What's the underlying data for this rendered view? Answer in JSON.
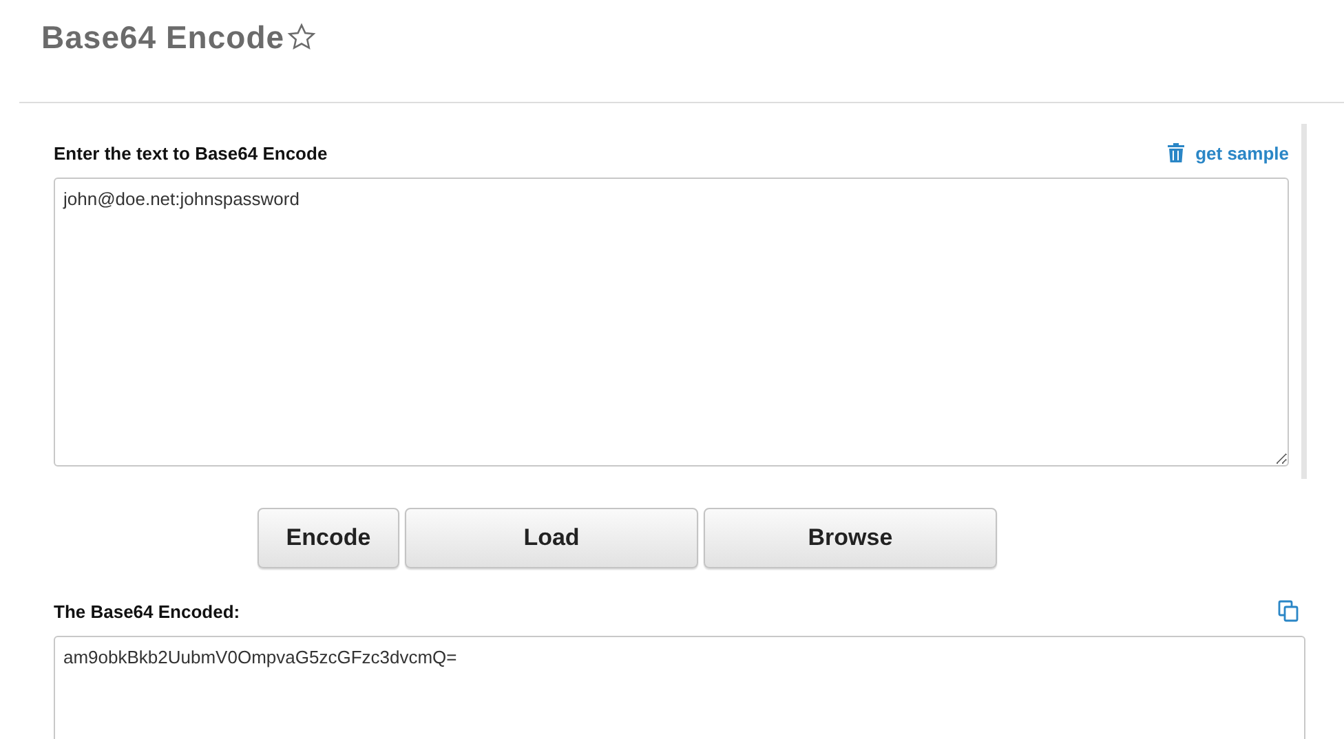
{
  "title": "Base64 Encode",
  "favorite": {
    "selected": false
  },
  "input": {
    "label": "Enter the text to Base64 Encode",
    "link": "get sample",
    "value": "john@doe.net:johnspassword"
  },
  "buttons": [
    "Encode",
    "Load",
    "Browse"
  ],
  "output": {
    "label": "The Base64 Encoded:",
    "value": "am9obkBkb2UubmV0OmpvaG5zcGFzc3dvcmQ="
  }
}
